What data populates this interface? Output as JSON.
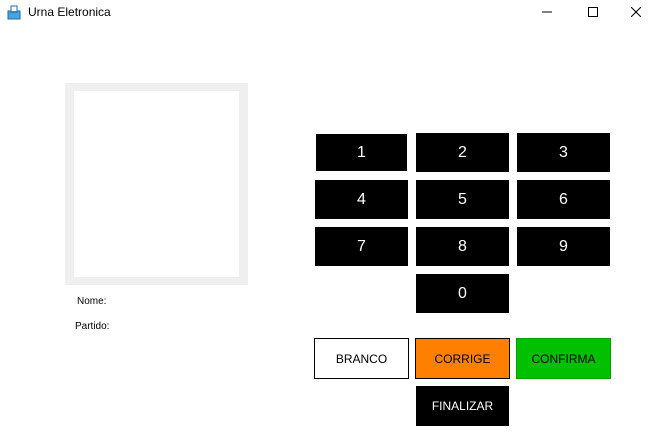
{
  "window": {
    "title": "Urna Eletronica",
    "app_icon": "ballot-box-icon",
    "controls": [
      "minimize-icon",
      "maximize-icon",
      "close-icon"
    ]
  },
  "candidate": {
    "nome_label": "Nome:",
    "partido_label": "Partido:"
  },
  "keypad": {
    "keys": [
      "1",
      "2",
      "3",
      "4",
      "5",
      "6",
      "7",
      "8",
      "9",
      "0"
    ]
  },
  "actions": {
    "branco": "BRANCO",
    "corrige": "CORRIGE",
    "confirma": "CONFIRMA",
    "finalizar": "FINALIZAR"
  },
  "colors": {
    "key_bg": "#000000",
    "corrige": "#ff8000",
    "confirma": "#00c000",
    "photo_frame": "#efefef"
  }
}
